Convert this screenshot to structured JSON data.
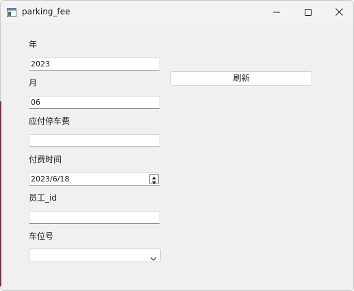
{
  "window": {
    "title": "parking_fee",
    "icons": {
      "app": "app-window-icon",
      "minimize": "minimize-icon",
      "maximize": "maximize-icon",
      "close": "close-icon"
    }
  },
  "form": {
    "year_label": "年",
    "year_value": "2023",
    "month_label": "月",
    "month_value": "06",
    "fee_label": "应付停车费",
    "fee_value": "",
    "paytime_label": "付费时间",
    "paytime_value": "2023/6/18",
    "employee_label": "员工_id",
    "employee_value": "",
    "spot_label": "车位号",
    "spot_value": ""
  },
  "actions": {
    "refresh_label": "刷新"
  }
}
